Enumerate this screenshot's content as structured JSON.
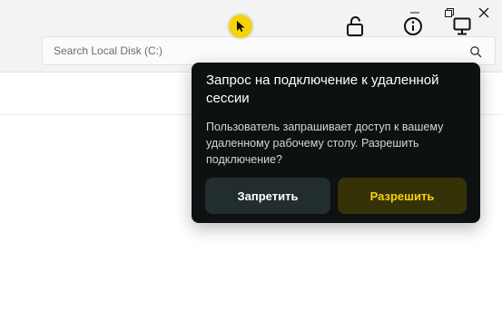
{
  "explorer": {
    "search_placeholder": "Search Local Disk (C:)"
  },
  "toolbar": {
    "items": [
      {
        "name": "cursor-control",
        "icon": "cursor-arrow-icon",
        "accent": "#f5d20c"
      },
      {
        "name": "lock",
        "icon": "unlock-icon"
      },
      {
        "name": "info",
        "icon": "info-icon"
      },
      {
        "name": "display",
        "icon": "monitor-icon"
      }
    ]
  },
  "window_controls": [
    "minimize",
    "restore",
    "close"
  ],
  "popup": {
    "title": "Запрос на подключение к удаленной сессии",
    "message": "Пользователь запрашивает доступ к вашему удаленному рабочему столу. Разрешить подключение?",
    "deny_label": "Запретить",
    "allow_label": "Разрешить"
  },
  "colors": {
    "accent": "#f5d20c",
    "popup_bg": "#0e1111",
    "deny_bg": "#222d2d",
    "allow_bg": "#363208"
  }
}
